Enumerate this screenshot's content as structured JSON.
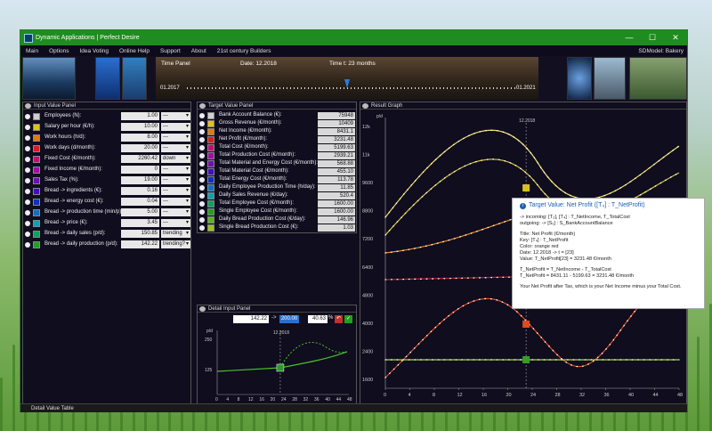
{
  "window": {
    "title": "Dynamic Applications | Perfect Desire",
    "sdmodel": "SDModel: Bakery"
  },
  "menu": [
    "Main",
    "Options",
    "Idea Voting",
    "Online Help",
    "Support",
    "About",
    "21st century Builders"
  ],
  "timepanel": {
    "label": "Time Panel",
    "date_label": "Date: 12.2018",
    "time_label": "Time t: 23 months",
    "start": "01.2017",
    "end": "01.2021",
    "position": 0.479
  },
  "input_panel": {
    "title": "Input Value Panel",
    "rows": [
      {
        "label": "Employees (N):",
        "value": "1.00",
        "color": "#cfcfcf",
        "ctl": "---"
      },
      {
        "label": "Salary per hour (€/h):",
        "value": "10.00",
        "color": "#e0c21a",
        "ctl": "---"
      },
      {
        "label": "Work hours (h/d):",
        "value": "8.00",
        "color": "#e07a10",
        "ctl": "---"
      },
      {
        "label": "Work days (d/month):",
        "value": "20.00",
        "color": "#d02020",
        "ctl": "---"
      },
      {
        "label": "Fixed Cost (€/month):",
        "value": "2260.42",
        "color": "#c21070",
        "ctl": "down"
      },
      {
        "label": "Fixed Income (€/month):",
        "value": "0",
        "color": "#a010a0",
        "ctl": "---"
      },
      {
        "label": "Sales Tax (%):",
        "value": "19.00",
        "color": "#7010b0",
        "ctl": "---"
      },
      {
        "label": "Bread -> ingredients (€):",
        "value": "0.16",
        "color": "#4010c0",
        "ctl": "---"
      },
      {
        "label": "Bread -> energy cost (€):",
        "value": "0.04",
        "color": "#1030c0",
        "ctl": "---"
      },
      {
        "label": "Bread -> production time (min/p):",
        "value": "5.00",
        "color": "#1070c0",
        "ctl": "---"
      },
      {
        "label": "Bread -> price (€):",
        "value": "3.45",
        "color": "#10a0b0",
        "ctl": "---"
      },
      {
        "label": "Bread -> daily sales (p/d):",
        "value": "150.85",
        "color": "#10a060",
        "ctl": "trending"
      },
      {
        "label": "Bread -> daily production (p/d):",
        "value": "142.22",
        "color": "#20a020",
        "ctl": "trending?"
      }
    ]
  },
  "target_panel": {
    "title": "Target Value Panel",
    "rows": [
      {
        "label": "Bank Account Balance (€):",
        "value": "75948",
        "color": "#cfcfcf"
      },
      {
        "label": "Gross Revenue (€/month):",
        "value": "10409",
        "color": "#e0c21a"
      },
      {
        "label": "Net Income (€/month):",
        "value": "8431.1",
        "color": "#e07a10"
      },
      {
        "label": "Net Profit (€/month):",
        "value": "3231.48",
        "color": "#d02020"
      },
      {
        "label": "Total Cost (€/month):",
        "value": "5199.63",
        "color": "#c21070"
      },
      {
        "label": "Total Production Cost (€/month):",
        "value": "2939.21",
        "color": "#a010a0"
      },
      {
        "label": "Total Material and Energy Cost (€/month):",
        "value": "568.88",
        "color": "#7010b0"
      },
      {
        "label": "Total Material Cost (€/month):",
        "value": "455.10",
        "color": "#4010c0"
      },
      {
        "label": "Total Energy Cost (€/month):",
        "value": "113.78",
        "color": "#1030c0"
      },
      {
        "label": "Daily Employee Production Time (h/day):",
        "value": "11.85",
        "color": "#1070c0"
      },
      {
        "label": "Daily Sales Revenue (€/day):",
        "value": "520.4",
        "color": "#10a0b0"
      },
      {
        "label": "Total Employee Cost (€/month):",
        "value": "1600.00",
        "color": "#10a060"
      },
      {
        "label": "Single Employee Cost (€/month):",
        "value": "1600.00",
        "color": "#20a020"
      },
      {
        "label": "Daily Bread Production Cost (€/day):",
        "value": "146.96",
        "color": "#60b020"
      },
      {
        "label": "Single Bread Production Cost (€):",
        "value": "1.03",
        "color": "#9ac020"
      }
    ]
  },
  "detail_panel": {
    "title": "Detail Input Panel",
    "v1": "142.22",
    "arrow": "->",
    "v2": "200.00",
    "v3": "40.63",
    "pct": "%",
    "unit": "p/d",
    "marker": "12.2018",
    "yticks": [
      "250",
      "125"
    ],
    "xticks": [
      "0",
      "4",
      "8",
      "12",
      "16",
      "20",
      "24",
      "28",
      "32",
      "36",
      "40",
      "44",
      "48"
    ]
  },
  "result_panel": {
    "title": "Result Graph",
    "unit": "p/d",
    "marker": "12.2018",
    "yticks": [
      "12k",
      "11k",
      "9600",
      "8800",
      "7200",
      "6400",
      "4800",
      "4000",
      "2400",
      "1600"
    ],
    "xticks": [
      "0",
      "4",
      "8",
      "12",
      "16",
      "20",
      "24",
      "28",
      "32",
      "36",
      "40",
      "44",
      "48"
    ]
  },
  "tooltip": {
    "title": "Target Value:  Net Profit  ([T₄] : T_NetProfit)",
    "incoming": "-> incoming:  [T₂], [T₄] : T_NetIncome,  T_TotalCost",
    "outgoing": "outgoing:  ->   [S₁] :  S_BankAccountBalance",
    "title_line": "Title:       Net Profit (€/month)",
    "key": "Key:         [T₄] : T_NetProfit",
    "color": "Color:       orange red",
    "date": "Date:        12.2018  ->  t = [23]",
    "value": "Value:       T_NetProfit[23] = 3231.48 €/month",
    "f1": "T_NetProfit    =  T_NetIncome - T_TotalCost",
    "f2": "T_NetProfit    =  8431.11 - 5199.63  =  3231.48 €/month",
    "desc": "Your Net Profit after Tax, which is your Net Income minus your Total Cost."
  },
  "statusbar": "Detail Value Table"
}
